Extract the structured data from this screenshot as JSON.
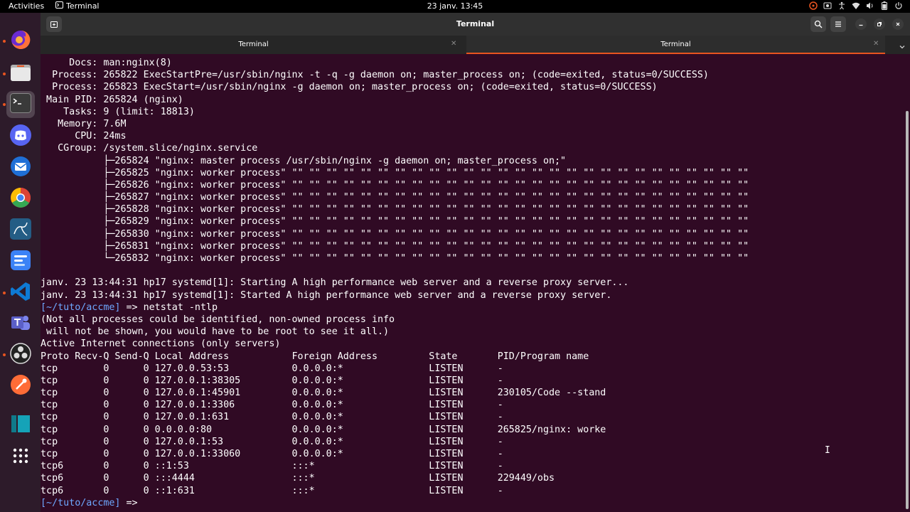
{
  "topbar": {
    "activities": "Activities",
    "app_name": "Terminal",
    "clock": "23 janv.  13:45"
  },
  "window": {
    "title": "Terminal",
    "tabs": [
      {
        "label": "Terminal",
        "active": false
      },
      {
        "label": "Terminal",
        "active": true
      }
    ]
  },
  "terminal": {
    "lines": [
      {
        "text": "     Docs: man:nginx(8)"
      },
      {
        "text": "  Process: 265822 ExecStartPre=/usr/sbin/nginx -t -q -g daemon on; master_process on; (code=exited, status=0/SUCCESS)"
      },
      {
        "text": "  Process: 265823 ExecStart=/usr/sbin/nginx -g daemon on; master_process on; (code=exited, status=0/SUCCESS)"
      },
      {
        "text": " Main PID: 265824 (nginx)"
      },
      {
        "text": "    Tasks: 9 (limit: 18813)"
      },
      {
        "text": "   Memory: 7.6M"
      },
      {
        "text": "      CPU: 24ms"
      },
      {
        "text": "   CGroup: /system.slice/nginx.service"
      },
      {
        "text": "           ├─265824 \"nginx: master process /usr/sbin/nginx -g daemon on; master_process on;\""
      },
      {
        "text": "           ├─265825 \"nginx: worker process\" \"\" \"\" \"\" \"\" \"\" \"\" \"\" \"\" \"\" \"\" \"\" \"\" \"\" \"\" \"\" \"\" \"\" \"\" \"\" \"\" \"\" \"\" \"\" \"\" \"\" \"\" \"\""
      },
      {
        "text": "           ├─265826 \"nginx: worker process\" \"\" \"\" \"\" \"\" \"\" \"\" \"\" \"\" \"\" \"\" \"\" \"\" \"\" \"\" \"\" \"\" \"\" \"\" \"\" \"\" \"\" \"\" \"\" \"\" \"\" \"\" \"\""
      },
      {
        "text": "           ├─265827 \"nginx: worker process\" \"\" \"\" \"\" \"\" \"\" \"\" \"\" \"\" \"\" \"\" \"\" \"\" \"\" \"\" \"\" \"\" \"\" \"\" \"\" \"\" \"\" \"\" \"\" \"\" \"\" \"\" \"\""
      },
      {
        "text": "           ├─265828 \"nginx: worker process\" \"\" \"\" \"\" \"\" \"\" \"\" \"\" \"\" \"\" \"\" \"\" \"\" \"\" \"\" \"\" \"\" \"\" \"\" \"\" \"\" \"\" \"\" \"\" \"\" \"\" \"\" \"\""
      },
      {
        "text": "           ├─265829 \"nginx: worker process\" \"\" \"\" \"\" \"\" \"\" \"\" \"\" \"\" \"\" \"\" \"\" \"\" \"\" \"\" \"\" \"\" \"\" \"\" \"\" \"\" \"\" \"\" \"\" \"\" \"\" \"\" \"\""
      },
      {
        "text": "           ├─265830 \"nginx: worker process\" \"\" \"\" \"\" \"\" \"\" \"\" \"\" \"\" \"\" \"\" \"\" \"\" \"\" \"\" \"\" \"\" \"\" \"\" \"\" \"\" \"\" \"\" \"\" \"\" \"\" \"\" \"\""
      },
      {
        "text": "           ├─265831 \"nginx: worker process\" \"\" \"\" \"\" \"\" \"\" \"\" \"\" \"\" \"\" \"\" \"\" \"\" \"\" \"\" \"\" \"\" \"\" \"\" \"\" \"\" \"\" \"\" \"\" \"\" \"\" \"\" \"\""
      },
      {
        "text": "           └─265832 \"nginx: worker process\" \"\" \"\" \"\" \"\" \"\" \"\" \"\" \"\" \"\" \"\" \"\" \"\" \"\" \"\" \"\" \"\" \"\" \"\" \"\" \"\" \"\" \"\" \"\" \"\" \"\" \"\" \"\""
      },
      {
        "text": ""
      },
      {
        "text": "janv. 23 13:44:31 hp17 systemd[1]: Starting A high performance web server and a reverse proxy server..."
      },
      {
        "text": "janv. 23 13:44:31 hp17 systemd[1]: Started A high performance web server and a reverse proxy server."
      },
      {
        "prompt": "[~/tuto/accme]",
        "text": " => netstat -ntlp"
      },
      {
        "text": "(Not all processes could be identified, non-owned process info"
      },
      {
        "text": " will not be shown, you would have to be root to see it all.)"
      },
      {
        "text": "Active Internet connections (only servers)"
      },
      {
        "text": "Proto Recv-Q Send-Q Local Address           Foreign Address         State       PID/Program name"
      },
      {
        "text": "tcp        0      0 127.0.0.53:53           0.0.0.0:*               LISTEN      -"
      },
      {
        "text": "tcp        0      0 127.0.0.1:38305         0.0.0.0:*               LISTEN      -"
      },
      {
        "text": "tcp        0      0 127.0.0.1:45901         0.0.0.0:*               LISTEN      230105/Code --stand"
      },
      {
        "text": "tcp        0      0 127.0.0.1:3306          0.0.0.0:*               LISTEN      -"
      },
      {
        "text": "tcp        0      0 127.0.0.1:631           0.0.0.0:*               LISTEN      -"
      },
      {
        "text": "tcp        0      0 0.0.0.0:80              0.0.0.0:*               LISTEN      265825/nginx: worke"
      },
      {
        "text": "tcp        0      0 127.0.0.1:53            0.0.0.0:*               LISTEN      -"
      },
      {
        "text": "tcp        0      0 127.0.0.1:33060         0.0.0.0:*               LISTEN      -"
      },
      {
        "text": "tcp6       0      0 ::1:53                  :::*                    LISTEN      -"
      },
      {
        "text": "tcp6       0      0 :::4444                 :::*                    LISTEN      229449/obs"
      },
      {
        "text": "tcp6       0      0 ::1:631                 :::*                    LISTEN      -"
      },
      {
        "prompt": "[~/tuto/accme]",
        "text": " => "
      }
    ]
  },
  "dock": {
    "apps": [
      {
        "icon": "firefox-icon",
        "color": "#ff7139",
        "running": true
      },
      {
        "icon": "files-icon",
        "color": "#e8e8e8",
        "running": true
      },
      {
        "icon": "terminal-icon",
        "color": "#3a3a3a",
        "running": true,
        "active": true
      },
      {
        "icon": "discord-icon",
        "color": "#5865f2",
        "running": false
      },
      {
        "icon": "thunderbird-icon",
        "color": "#1f6fd6",
        "running": false
      },
      {
        "icon": "chrome-icon",
        "color": "#34a853",
        "running": false
      },
      {
        "icon": "mysql-workbench-icon",
        "color": "#245d85",
        "running": false
      },
      {
        "icon": "todo-icon",
        "color": "#3b82f6",
        "running": false
      },
      {
        "icon": "vscode-icon",
        "color": "#0e7ad4",
        "running": true
      },
      {
        "icon": "teams-icon",
        "color": "#5b5fc7",
        "running": false
      },
      {
        "icon": "obs-icon",
        "color": "#222222",
        "running": true
      },
      {
        "icon": "postman-icon",
        "color": "#ff6c37",
        "running": false
      },
      {
        "icon": "window-icon",
        "color": "#0f7a8a",
        "running": false
      },
      {
        "icon": "app-grid-icon",
        "color": "#ffffff",
        "running": false
      }
    ]
  },
  "colors": {
    "terminal_bg": "#300a24",
    "prompt_dir": "#6ea8ff",
    "accent": "#e95420"
  }
}
